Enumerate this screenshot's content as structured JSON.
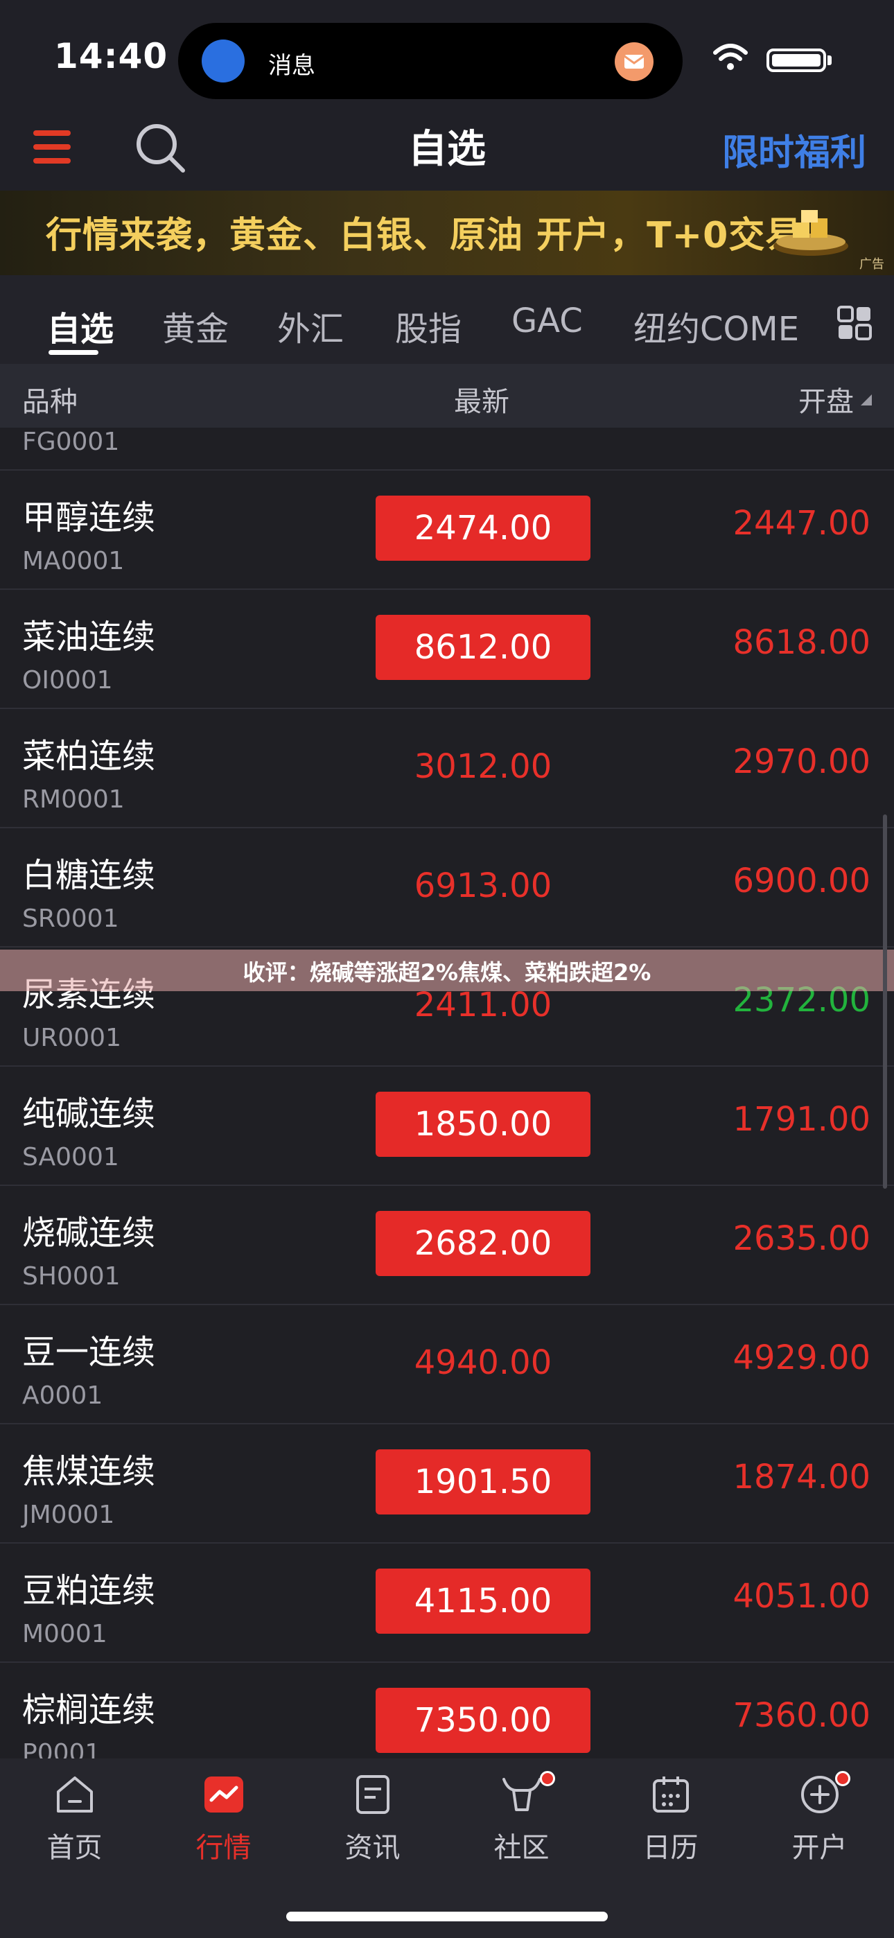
{
  "status_bar": {
    "time": "14:40",
    "island_label": "消息"
  },
  "header": {
    "title": "自选",
    "promo": "限时福利"
  },
  "banner": {
    "text": "行情来袭，黄金、白银、原油 开户，T+0交易",
    "ad_tag": "广告"
  },
  "tabs": [
    "自选",
    "黄金",
    "外汇",
    "股指",
    "GAC",
    "纽约COME"
  ],
  "columns": {
    "name": "品种",
    "latest": "最新",
    "open": "开盘"
  },
  "partial_code": "FG0001",
  "rows": [
    {
      "name": "甲醇连续",
      "code": "MA0001",
      "latest": "2474.00",
      "open": "2447.00"
    },
    {
      "name": "菜油连续",
      "code": "OI0001",
      "latest": "8612.00",
      "open": "8618.00"
    },
    {
      "name": "菜柏连续",
      "code": "RM0001",
      "latest": "3012.00",
      "open": "2970.00"
    },
    {
      "name": "白糖连续",
      "code": "SR0001",
      "latest": "6913.00",
      "open": "6900.00"
    },
    {
      "name": "尿素连续",
      "code": "UR0001",
      "latest": "2411.00",
      "open": "2372.00"
    },
    {
      "name": "纯碱连续",
      "code": "SA0001",
      "latest": "1850.00",
      "open": "1791.00"
    },
    {
      "name": "烧碱连续",
      "code": "SH0001",
      "latest": "2682.00",
      "open": "2635.00"
    },
    {
      "name": "豆一连续",
      "code": "A0001",
      "latest": "4940.00",
      "open": "4929.00"
    },
    {
      "name": "焦煤连续",
      "code": "JM0001",
      "latest": "1901.50",
      "open": "1874.00"
    },
    {
      "name": "豆粕连续",
      "code": "M0001",
      "latest": "4115.00",
      "open": "4051.00"
    },
    {
      "name": "棕榈连续",
      "code": "P0001",
      "latest": "7350.00",
      "open": "7360.00"
    }
  ],
  "row_styles": [
    {
      "latest_highlight": true,
      "open_color": "up"
    },
    {
      "latest_highlight": true,
      "open_color": "up"
    },
    {
      "latest_highlight": false,
      "open_color": "up"
    },
    {
      "latest_highlight": false,
      "open_color": "up"
    },
    {
      "latest_highlight": false,
      "open_color": "down"
    },
    {
      "latest_highlight": true,
      "open_color": "up"
    },
    {
      "latest_highlight": true,
      "open_color": "up"
    },
    {
      "latest_highlight": false,
      "open_color": "up"
    },
    {
      "latest_highlight": true,
      "open_color": "up"
    },
    {
      "latest_highlight": true,
      "open_color": "up"
    },
    {
      "latest_highlight": true,
      "open_color": "up"
    }
  ],
  "news_overlay": "收评：烧碱等涨超2%焦煤、菜粕跌超2%",
  "bottom_nav": [
    "首页",
    "行情",
    "资讯",
    "社区",
    "日历",
    "开户"
  ],
  "colors": {
    "up": "#e8302a",
    "down": "#22b33d",
    "accent_blue": "#3f7fe6",
    "highlight": "#e52a28"
  }
}
